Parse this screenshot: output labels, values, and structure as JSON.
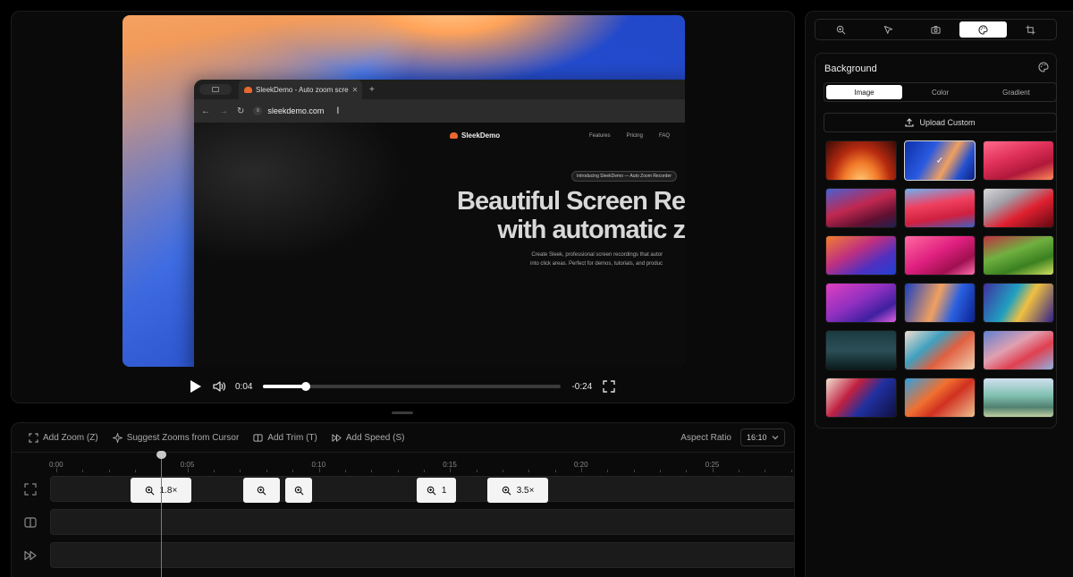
{
  "browser": {
    "tab_title": "SleekDemo - Auto zoom scre",
    "url": "sleekdemo.com"
  },
  "site": {
    "logo": "SleekDemo",
    "nav": [
      "Features",
      "Pricing",
      "FAQ"
    ],
    "badge": "Introducing SleekDemo — Auto Zoom Recorder",
    "hero_line1": "Beautiful Screen Re",
    "hero_line2": "with automatic z",
    "sub_line1": "Create Sleek, professional screen recordings that autor",
    "sub_line2": "into click areas. Perfect for demos, tutorials, and produc"
  },
  "player": {
    "current_time": "0:04",
    "remaining_time": "-0:24",
    "progress": 0.143
  },
  "timeline": {
    "toolbar": {
      "add_zoom": "Add Zoom (Z)",
      "suggest_zooms": "Suggest Zooms from Cursor",
      "add_trim": "Add Trim (T)",
      "add_speed": "Add Speed (S)",
      "aspect_label": "Aspect Ratio",
      "aspect_value": "16:10"
    },
    "ticks": [
      "0:00",
      "0:05",
      "0:10",
      "0:15",
      "0:20",
      "0:25"
    ],
    "duration_seconds": 28,
    "playhead_seconds": 4,
    "zoom_segments": [
      {
        "label": "1.8×",
        "start": 2.8,
        "end": 5.1
      },
      {
        "label": "",
        "start": 7.1,
        "end": 8.5
      },
      {
        "label": "",
        "start": 8.7,
        "end": 9.7
      },
      {
        "label": "1",
        "start": 13.7,
        "end": 15.2
      },
      {
        "label": "3.5×",
        "start": 16.4,
        "end": 18.7
      }
    ]
  },
  "sidebar": {
    "tool_tabs": [
      "zoom-icon",
      "cursor-icon",
      "camera-icon",
      "palette-icon",
      "crop-icon"
    ],
    "active_tool": "palette-icon",
    "section_title": "Background",
    "segments": [
      "Image",
      "Color",
      "Gradient"
    ],
    "active_segment": "Image",
    "upload_label": "Upload Custom",
    "selected_index": 1,
    "check_glyph": "✓"
  },
  "colors": {
    "accent": "#ffffff",
    "panel": "#0a0a0a",
    "brand": "#e8682d"
  }
}
